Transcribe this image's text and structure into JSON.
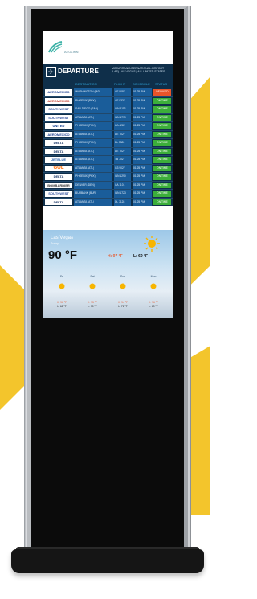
{
  "header": {
    "logo_text": "AEGLINN",
    "title": "DEPARTURE",
    "airport": "MCCARRAN INTERNATIONAL AIRPORT (LAS) LAS VEGAS | ALL UNITED STATES"
  },
  "columns": {
    "destination": "DESTINATION",
    "flight": "FLIGHT",
    "schedule": "SCHEDULE",
    "status": "STATUS"
  },
  "flights": [
    {
      "airline": "AEROMEXICO",
      "dest": "WASHINGTON (IAD)",
      "flight": "AE 9087",
      "time": "01:25 PM",
      "status": "DELAYED"
    },
    {
      "airline": "AEROMEXICO",
      "dest": "PHOENIX (PHX)",
      "flight": "AE 9337",
      "time": "01:25 PM",
      "status": "ON TIME"
    },
    {
      "airline": "SOUTHWEST",
      "dest": "SAN DIEGO (SAN)",
      "flight": "WN 6113",
      "time": "01:25 PM",
      "status": "ON TIME"
    },
    {
      "airline": "SOUTHWEST",
      "dest": "ATLANTA (ATL)",
      "flight": "WN 1779",
      "time": "01:25 PM",
      "status": "ON TIME"
    },
    {
      "airline": "UNITED",
      "dest": "PHOENIX (PHX)",
      "flight": "UA 4282",
      "time": "01:25 PM",
      "status": "ON TIME"
    },
    {
      "airline": "AEROMEXICO",
      "dest": "ATLANTA (ATL)",
      "flight": "AE 7027",
      "time": "01:25 PM",
      "status": "ON TIME"
    },
    {
      "airline": "DELTA",
      "dest": "PHOENIX (PHX)",
      "flight": "DL 5581",
      "time": "01:25 PM",
      "status": "ON TIME"
    },
    {
      "airline": "DELTA",
      "dest": "ATLANTA (ATL)",
      "flight": "AE 7027",
      "time": "01:25 PM",
      "status": "ON TIME"
    },
    {
      "airline": "JETBLUE",
      "dest": "ATLANTA (ATL)",
      "flight": "TB 7027",
      "time": "01:25 PM",
      "status": "ON TIME"
    },
    {
      "airline": "GOL",
      "dest": "ATLANTA (ATL)",
      "flight": "G3 9027",
      "time": "01:25 PM",
      "status": "ON TIME"
    },
    {
      "airline": "DELTA",
      "dest": "PHOENIX (PHX)",
      "flight": "WN 1290",
      "time": "01:25 PM",
      "status": "ON TIME"
    },
    {
      "airline": "BOMBARDIER",
      "dest": "DENVER (DEN)",
      "flight": "CA 1101",
      "time": "01:25 PM",
      "status": "ON TIME"
    },
    {
      "airline": "SOUTHWEST",
      "dest": "BURBANK (BUR)",
      "flight": "WN 1723",
      "time": "01:25 PM",
      "status": "ON TIME"
    },
    {
      "airline": "DELTA",
      "dest": "ATLANTA (ATL)",
      "flight": "DL 7128",
      "time": "01:25 PM",
      "status": "ON TIME"
    }
  ],
  "weather": {
    "city": "Las Vegas",
    "condition": "Sunny",
    "temp": "90 °F",
    "high": "H: 97 °F",
    "low": "L: 69 °F",
    "forecast": [
      {
        "day": "Fri",
        "hi": "H: 96 °F",
        "lo": "L: 68 °F"
      },
      {
        "day": "Sat",
        "hi": "H: 95 °F",
        "lo": "L: 70 °F"
      },
      {
        "day": "Sun",
        "hi": "H: 94 °F",
        "lo": "L: 71 °F"
      },
      {
        "day": "Mon",
        "hi": "H: 96 °F",
        "lo": "L: 69 °F"
      }
    ]
  },
  "colors": {
    "accent_yellow": "#f3c52c",
    "board_navy": "#0f2f4a",
    "row_blue": "#1a5d9a",
    "on_time_green": "#3cae3a",
    "delayed_orange": "#e8542a"
  }
}
